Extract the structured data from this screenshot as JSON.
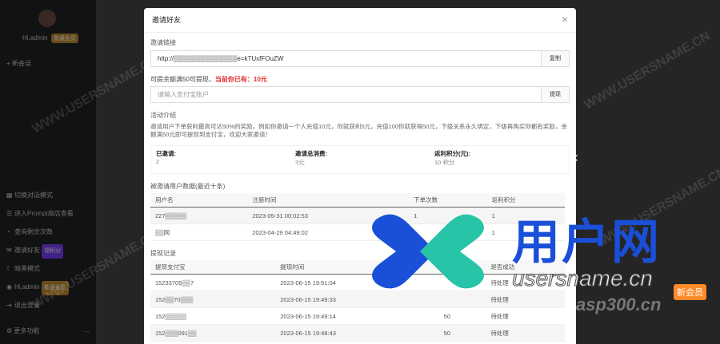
{
  "sidebar": {
    "user_name": "Hi,admin",
    "user_badge": "普通会员",
    "new_chat": "+ 新会话",
    "items": [
      {
        "icon": "grid-icon",
        "label": "切换对话模式"
      },
      {
        "icon": "prompt-icon",
        "label": "进入Prompt商店查看"
      },
      {
        "icon": "count-icon",
        "label": "查询剩余次数"
      },
      {
        "icon": "invite-icon",
        "label": "邀请好友",
        "badge": "领积分"
      },
      {
        "icon": "moon-icon",
        "label": "暗黑模式"
      },
      {
        "icon": "user-icon",
        "label": "Hi,admin",
        "badge": "普通会员"
      },
      {
        "icon": "logout-icon",
        "label": "退出登录"
      }
    ],
    "more": "更多功能",
    "more_dots": "..."
  },
  "modal": {
    "title": "邀请好友",
    "close": "×",
    "link_label": "邀请链接",
    "link_value": "http://▒▒▒▒▒▒▒▒▒▒▒▒▒▒e=kTUxfFOuZW",
    "copy_btn": "复制",
    "withdraw_text": "可提余额满50可提现，",
    "withdraw_amount_label": "当前你已有：",
    "withdraw_amount": "10元",
    "alipay_placeholder": "请输入支付宝账户",
    "withdraw_btn": "提现",
    "intro_title": "活动介绍",
    "intro_text": "邀请用户下单获利最高可达50%的奖励，例如你邀请一个人充值10元，你就获利5元，充值100你就获得50元，下级关系永久绑定，下级再购买你都有奖励，余额满50元即可提现到支付宝，欢迎大家邀请！",
    "stats": [
      {
        "label": "已邀请:",
        "value": "2"
      },
      {
        "label": "邀请总消费:",
        "value": "3元"
      },
      {
        "label": "返利积分(元):",
        "value": "10 积分"
      }
    ],
    "invited_title": "被邀请用户数据(最近十条)",
    "invited_headers": [
      "用户名",
      "注册时间",
      "下单次数",
      "返利积分"
    ],
    "invited_rows": [
      [
        "227▒▒▒▒▒",
        "2023-05-31 00:02:53",
        "1",
        "1"
      ],
      [
        "▒▒网",
        "2023-04-29 04:49:02",
        "",
        "1"
      ]
    ],
    "withdraw_title": "提现记录",
    "withdraw_headers": [
      "提现支付宝",
      "提现时间",
      "金额",
      "是否成功"
    ],
    "withdraw_rows": [
      [
        "15233705▒▒7",
        "2023-06-15 19:51:04",
        "",
        "待处理"
      ],
      [
        "152▒▒70▒▒▒",
        "2023-06-15 19:49:33",
        "",
        "待处理"
      ],
      [
        "152▒▒▒▒▒",
        "2023-06-15 19:49:14",
        "50",
        "待处理"
      ],
      [
        "152▒▒▒091▒▒",
        "2023-06-15 19:48:43",
        "50",
        "待处理"
      ]
    ]
  },
  "watermark": {
    "brand_cn": "用户网",
    "brand_url": "usersname.cn",
    "brand_sub": "asp300.cn",
    "tag": "新会员",
    "diag": "WWW.USERSNAME.CN"
  },
  "colors": {
    "accent_red": "#e03030",
    "brand_blue": "#1a4fd8",
    "badge_orange": "#c08a2e",
    "badge_purple": "#7b3ff2"
  }
}
